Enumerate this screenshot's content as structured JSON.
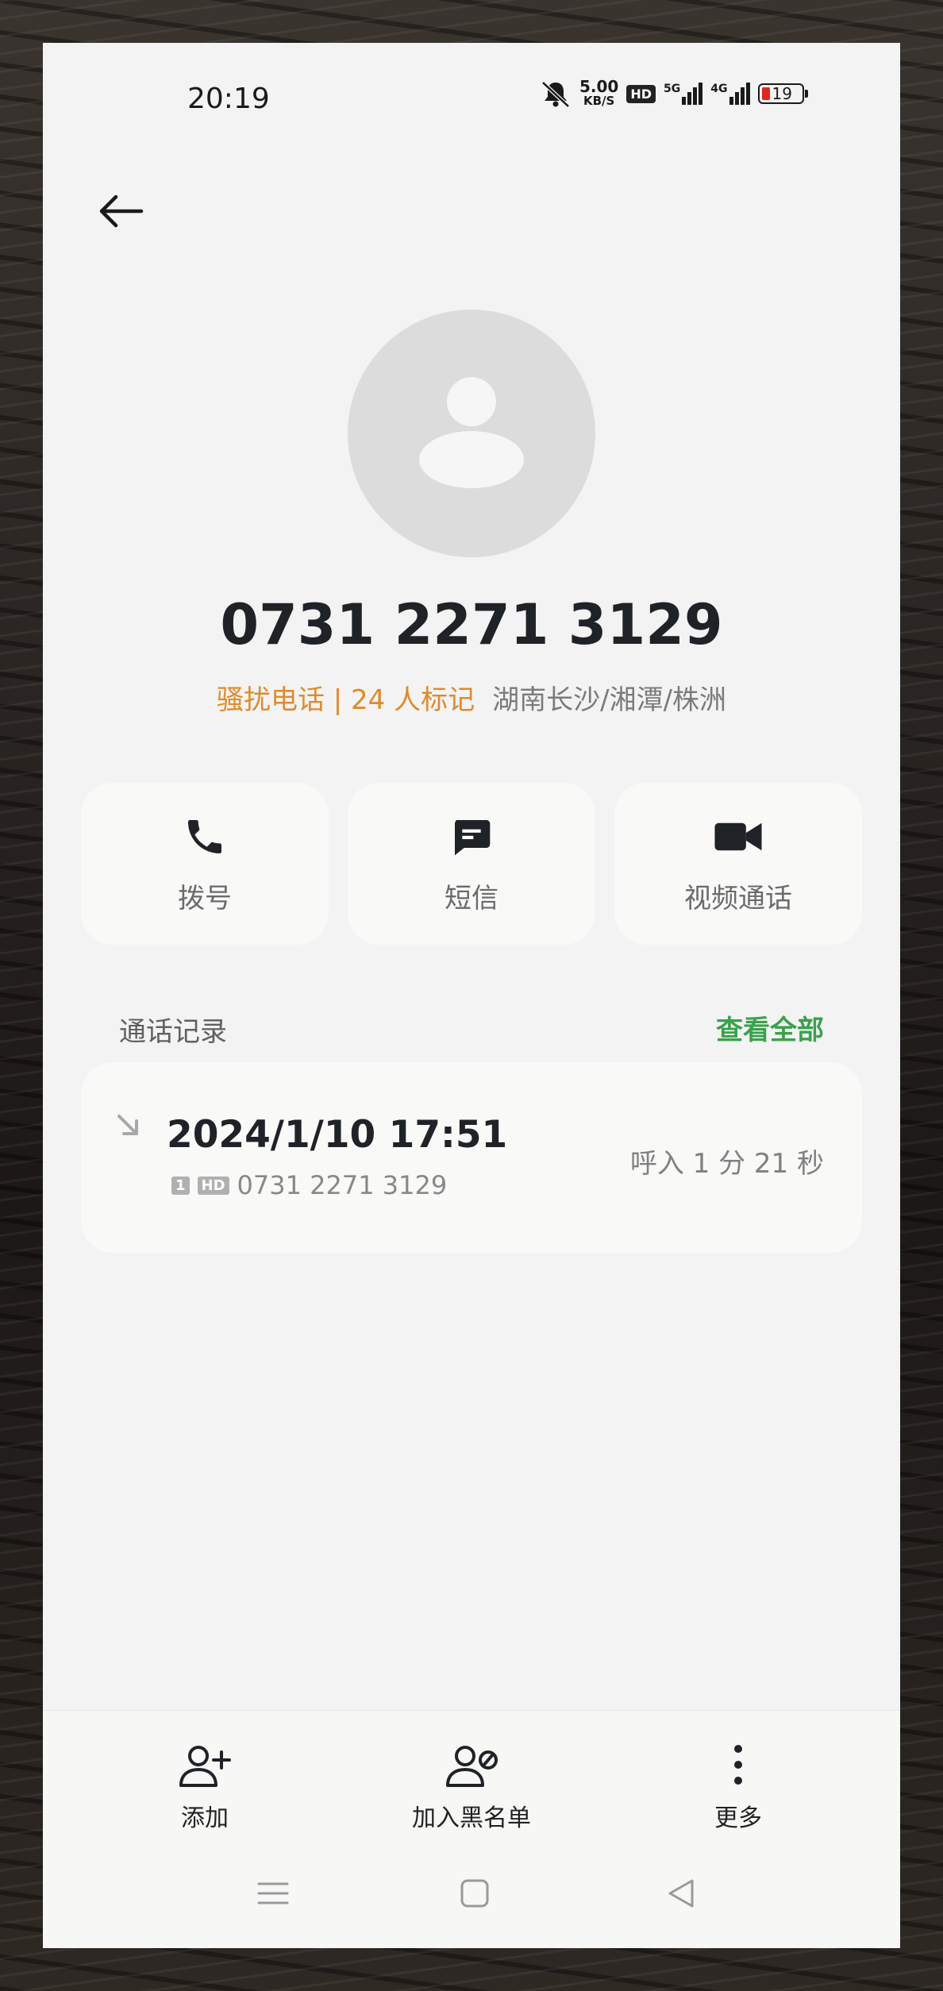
{
  "status": {
    "time": "20:19",
    "speed_value": "5.00",
    "speed_unit": "KB/S",
    "hd_badge": "HD",
    "net1": "5G",
    "net2": "4G",
    "battery": "19",
    "battery_color": "#e0281e"
  },
  "contact": {
    "number": "0731 2271 3129",
    "spam_label": "骚扰电话 | 24 人标记",
    "region": "湖南长沙/湘潭/株洲"
  },
  "actions": {
    "dial": "拨号",
    "sms": "短信",
    "video": "视频通话"
  },
  "call_log": {
    "title": "通话记录",
    "view_all": "查看全部",
    "entries": [
      {
        "datetime": "2024/1/10 17:51",
        "sim": "1",
        "hd": "HD",
        "number": "0731 2271 3129",
        "type_duration": "呼入  1 分 21 秒"
      }
    ]
  },
  "bottom": {
    "add": "添加",
    "blacklist": "加入黑名单",
    "more": "更多"
  },
  "colors": {
    "accent_green": "#3aa14d",
    "spam_orange": "#e08a2c"
  }
}
